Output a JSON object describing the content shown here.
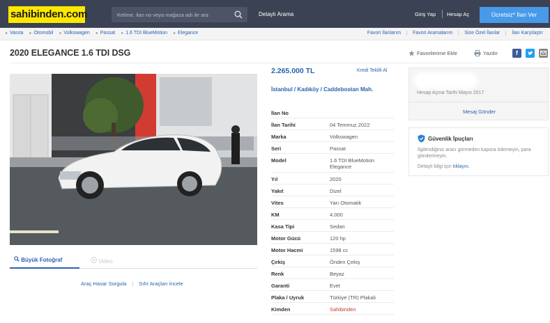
{
  "header": {
    "logo": "sahibinden.com",
    "search_placeholder": "Kelime, ilan no veya mağaza adı ile ara",
    "advanced_search": "Detaylı Arama",
    "login": "Giriş Yap",
    "register": "Hesap Aç",
    "post_ad": "Ücretsiz* İlan Ver"
  },
  "breadcrumb": [
    "Vasıta",
    "Otomobil",
    "Volkswagen",
    "Passat",
    "1.6 TDI BlueMotion",
    "Elegance"
  ],
  "top_links": [
    "Favori İlanlarım",
    "Favori Aramalarım",
    "Size Özel İlanlar",
    "İlan Karşılaştır"
  ],
  "listing": {
    "title": "2020 ELEGANCE 1.6 TDI DSG",
    "add_favorite": "Favorilerime Ekle",
    "print": "Yazdır",
    "price": "2.265.000 TL",
    "credit_offer": "Kredi Teklifi Al",
    "location": "İstanbul / Kadıköy / Caddebostan Mah."
  },
  "details": [
    {
      "k": "İlan No",
      "v": ""
    },
    {
      "k": "İlan Tarihi",
      "v": "04 Temmuz 2022"
    },
    {
      "k": "Marka",
      "v": "Volkswagen"
    },
    {
      "k": "Seri",
      "v": "Passat"
    },
    {
      "k": "Model",
      "v": "1.6 TDI BlueMotion Elegance"
    },
    {
      "k": "Yıl",
      "v": "2020"
    },
    {
      "k": "Yakıt",
      "v": "Dizel"
    },
    {
      "k": "Vites",
      "v": "Yarı Otomatik"
    },
    {
      "k": "KM",
      "v": "4.000"
    },
    {
      "k": "Kasa Tipi",
      "v": "Sedan"
    },
    {
      "k": "Motor Gücü",
      "v": "120 hp"
    },
    {
      "k": "Motor Hacmi",
      "v": "1598 cc"
    },
    {
      "k": "Çekiş",
      "v": "Önden Çekiş"
    },
    {
      "k": "Renk",
      "v": "Beyaz"
    },
    {
      "k": "Garanti",
      "v": "Evet"
    },
    {
      "k": "Plaka / Uyruk",
      "v": "Türkiye (TR) Plakalı"
    },
    {
      "k": "Kimden",
      "v": "Sahibinden"
    }
  ],
  "photo_tabs": {
    "photo": "Büyük Fotoğraf",
    "video": "Video"
  },
  "photo_links": {
    "damage": "Araç Hasar Sorgula",
    "new_cars": "Sıfır Araçları İncele"
  },
  "seller": {
    "since": "Hesap Açma Tarihi  Mayıs 2017",
    "message": "Mesaj Gönder"
  },
  "security": {
    "title": "Güvenlik İpuçları",
    "body": "İlgilendiğiniz aracı görmeden kapora ödemeyin, para göndermeyin.",
    "more_prefix": "Detaylı bilgi için",
    "more_link": "tıklayın."
  },
  "colors": {
    "header_bg": "#3b4254",
    "logo_bg": "#ffe800",
    "accent": "#489ae9",
    "link": "#2b62b0"
  }
}
